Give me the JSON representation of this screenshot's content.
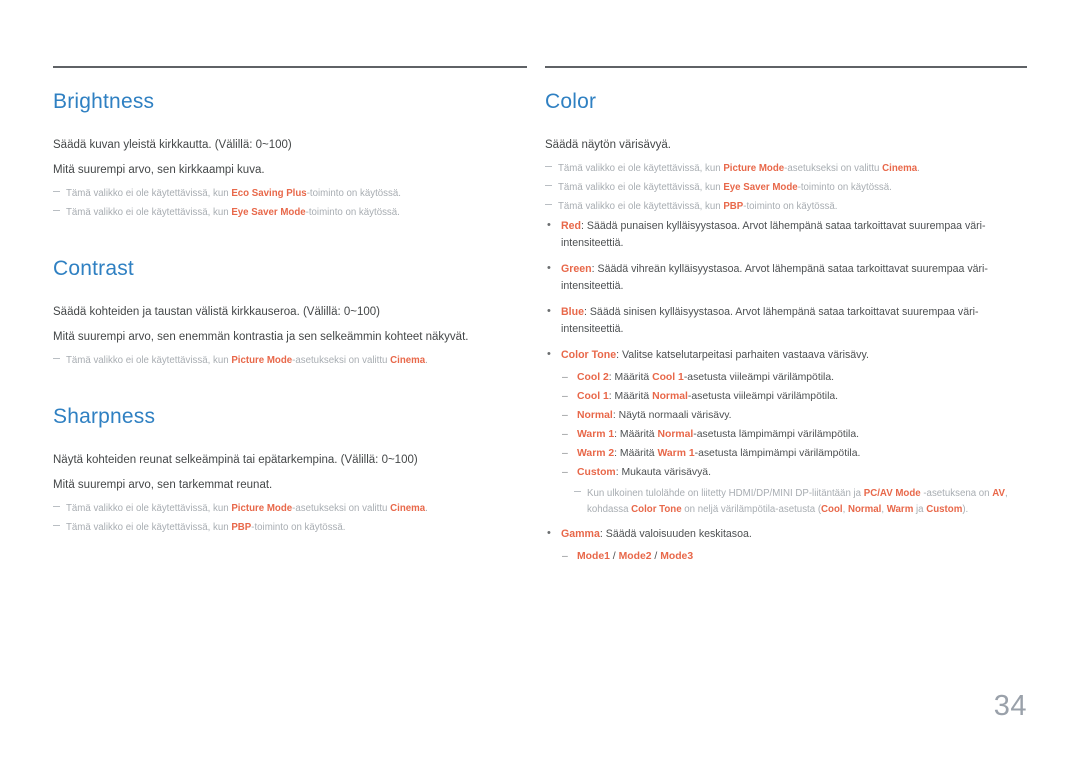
{
  "page": {
    "number": "34",
    "accent_heading_color": "#2f80c2",
    "accent_term_color": "#e8684a",
    "note_color": "#a8adb2"
  },
  "left_column": {
    "sections": [
      {
        "title": "Brightness",
        "body": [
          "Säädä kuvan yleistä kirkkautta. (Välillä: 0~100)",
          "Mitä suurempi arvo, sen kirkkaampi kuva."
        ],
        "notes": [
          {
            "pre": "Tämä valikko ei ole käytettävissä, kun ",
            "term": "Eco Saving Plus",
            "post": "-toiminto on käytössä."
          },
          {
            "pre": "Tämä valikko ei ole käytettävissä, kun ",
            "term": "Eye Saver Mode",
            "post": "-toiminto on käytössä."
          }
        ]
      },
      {
        "title": "Contrast",
        "body": [
          "Säädä kohteiden ja taustan välistä kirkkauseroa. (Välillä: 0~100)",
          "Mitä suurempi arvo, sen enemmän kontrastia ja sen selkeämmin kohteet näkyvät."
        ],
        "notes": [
          {
            "pre": "Tämä valikko ei ole käytettävissä, kun ",
            "term": "Picture Mode",
            "mid": "-asetukseksi on valittu ",
            "term2": "Cinema",
            "post": "."
          }
        ]
      },
      {
        "title": "Sharpness",
        "body": [
          "Näytä kohteiden reunat selkeämpinä tai epätarkempina. (Välillä: 0~100)",
          "Mitä suurempi arvo, sen tarkemmat reunat."
        ],
        "notes": [
          {
            "pre": "Tämä valikko ei ole käytettävissä, kun ",
            "term": "Picture Mode",
            "mid": "-asetukseksi on valittu ",
            "term2": "Cinema",
            "post": "."
          },
          {
            "pre": "Tämä valikko ei ole käytettävissä, kun ",
            "term": "PBP",
            "post": "-toiminto on käytössä."
          }
        ]
      }
    ]
  },
  "right_column": {
    "title": "Color",
    "body": "Säädä näytön värisävyä.",
    "notes": [
      {
        "pre": "Tämä valikko ei ole käytettävissä, kun ",
        "term": "Picture Mode",
        "mid": "-asetukseksi on valittu ",
        "term2": "Cinema",
        "post": "."
      },
      {
        "pre": "Tämä valikko ei ole käytettävissä, kun ",
        "term": "Eye Saver Mode",
        "post": "-toiminto on käytössä."
      },
      {
        "pre": "Tämä valikko ei ole käytettävissä, kun ",
        "term": "PBP",
        "post": "-toiminto on käytössä."
      }
    ],
    "bullets": [
      {
        "term": "Red",
        "text": ": Säädä punaisen kylläisyystasoa. Arvot lähempänä sataa tarkoittavat suurempaa väri-intensiteettiä."
      },
      {
        "term": "Green",
        "text": ": Säädä vihreän kylläisyystasoa. Arvot lähempänä sataa tarkoittavat suurempaa väri-intensiteettiä."
      },
      {
        "term": "Blue",
        "text": ": Säädä sinisen kylläisyystasoa. Arvot lähempänä sataa tarkoittavat suurempaa väri-intensiteettiä."
      }
    ],
    "color_tone": {
      "term": "Color Tone",
      "text": ": Valitse katselutarpeitasi parhaiten vastaava värisävy.",
      "subitems": [
        {
          "term": "Cool 2",
          "pre": ": Määritä ",
          "term2": "Cool 1",
          "post": "-asetusta viileämpi värilämpötila."
        },
        {
          "term": "Cool 1",
          "pre": ": Määritä ",
          "term2": "Normal",
          "post": "-asetusta viileämpi värilämpötila."
        },
        {
          "term": "Normal",
          "pre": ": Näytä normaali värisävy.",
          "term2": "",
          "post": ""
        },
        {
          "term": "Warm 1",
          "pre": ": Määritä ",
          "term2": "Normal",
          "post": "-asetusta lämpimämpi värilämpötila."
        },
        {
          "term": "Warm 2",
          "pre": ": Määritä ",
          "term2": "Warm 1",
          "post": "-asetusta lämpimämpi värilämpötila."
        },
        {
          "term": "Custom",
          "pre": ": Mukauta värisävyä.",
          "term2": "",
          "post": ""
        }
      ],
      "note": {
        "p1": "Kun ulkoinen tulolähde on liitetty HDMI/DP/MINI DP-liitäntään ja ",
        "t1": "PC/AV Mode",
        "p2": " -asetuksena on ",
        "t2": "AV",
        "p3": ", kohdassa ",
        "t3": "Color Tone",
        "p4": " on neljä värilämpötila-asetusta (",
        "t4": "Cool",
        "p5": ", ",
        "t5": "Normal",
        "p6": ", ",
        "t6": "Warm",
        "p7": " ja ",
        "t7": "Custom",
        "p8": ")."
      }
    },
    "gamma": {
      "term": "Gamma",
      "text": ": Säädä valoisuuden keskitasoa.",
      "modes": [
        "Mode1",
        "Mode2",
        "Mode3"
      ],
      "separator": " / "
    }
  }
}
